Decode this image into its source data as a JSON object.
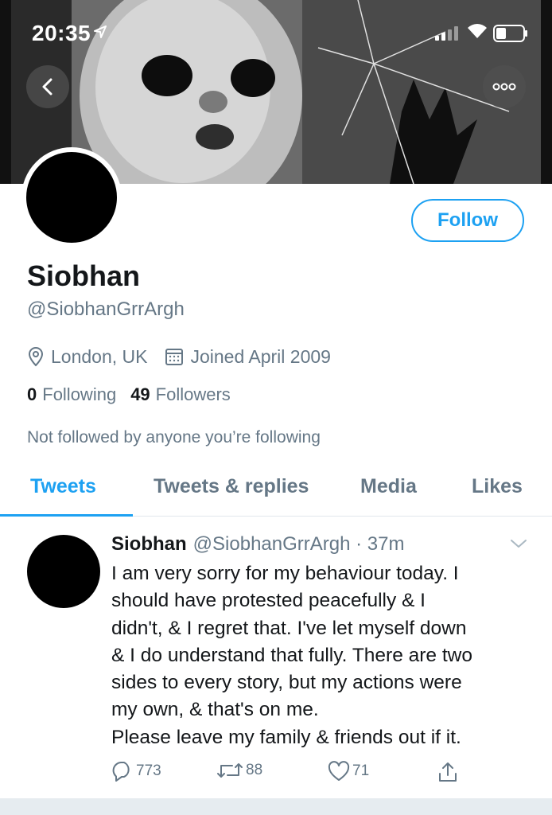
{
  "status_bar": {
    "time": "20:35"
  },
  "profile": {
    "follow_label": "Follow",
    "name": "Siobhan",
    "handle": "@SiobhanGrrArgh",
    "location": "London, UK",
    "joined": "Joined April 2009",
    "following_count": "0",
    "following_label": "Following",
    "followers_count": "49",
    "followers_label": "Followers",
    "not_followed": "Not followed by anyone you’re following"
  },
  "tabs": [
    {
      "label": "Tweets",
      "active": true
    },
    {
      "label": "Tweets & replies",
      "active": false
    },
    {
      "label": "Media",
      "active": false
    },
    {
      "label": "Likes",
      "active": false
    }
  ],
  "tweet": {
    "name": "Siobhan",
    "handle_time": "@SiobhanGrrArgh · 37m",
    "lines": [
      "I am very sorry for my behaviour today. I",
      "should have protested peacefully & I",
      "didn't, & I regret that. I've let myself down",
      "& I do understand that fully. There are two",
      "sides to every story, but my actions were",
      "my own, & that's on me.",
      "Please leave my family & friends out if it."
    ],
    "replies": "773",
    "retweets": "88",
    "likes": "71"
  },
  "icons": {
    "back": "chevron-left-icon",
    "more": "more-icon",
    "location": "location-pin-icon",
    "calendar": "calendar-icon",
    "reply": "reply-icon",
    "retweet": "retweet-icon",
    "like": "heart-icon",
    "share": "share-icon"
  },
  "colors": {
    "accent": "#1da1f2",
    "secondary_text": "#657786",
    "primary_text": "#14171a"
  }
}
